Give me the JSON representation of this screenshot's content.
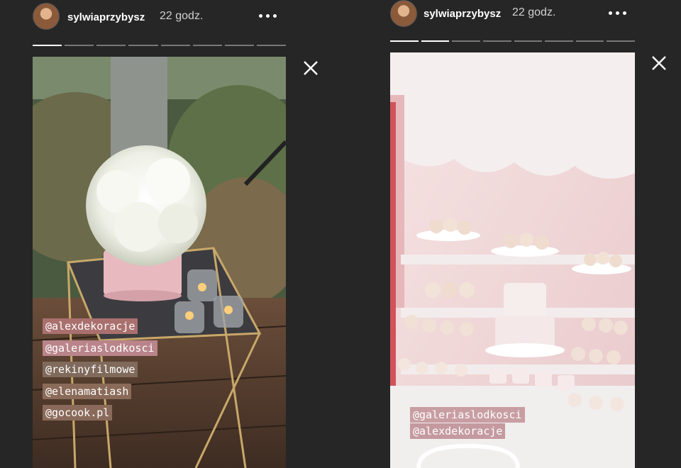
{
  "stories": [
    {
      "username": "sylwiaprzybysz",
      "time": "22 godz.",
      "mentions": [
        "@alexdekoracje",
        "@galeriaslodkosci",
        "@rekinyfilmowe",
        "@elenamatiash",
        "@gocook.pl"
      ],
      "progress": {
        "segments": 8,
        "current": 1
      }
    },
    {
      "username": "sylwiaprzybysz",
      "time": "22 godz.",
      "mentions": [
        "@galeriaslodkosci",
        "@alexdekoracje"
      ],
      "progress": {
        "segments": 8,
        "current": 2
      }
    }
  ],
  "icons": {
    "more": "more-horizontal-icon",
    "close": "close-icon"
  },
  "colors": {
    "background": "#262626",
    "mention_bg": "rgba(170,120,120,0.75)"
  }
}
